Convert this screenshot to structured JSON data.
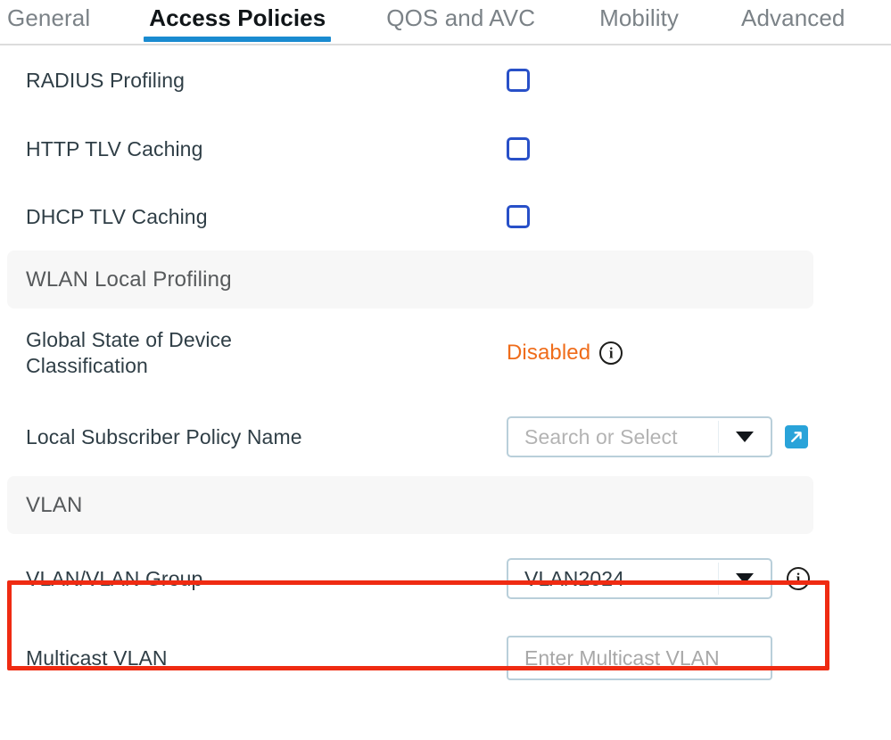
{
  "tabs": [
    {
      "label": "General",
      "active": false
    },
    {
      "label": "Access Policies",
      "active": true
    },
    {
      "label": "QOS and AVC",
      "active": false
    },
    {
      "label": "Mobility",
      "active": false
    },
    {
      "label": "Advanced",
      "active": false
    }
  ],
  "rows": {
    "radius_profiling": {
      "label": "RADIUS Profiling",
      "checked": false
    },
    "http_tlv_caching": {
      "label": "HTTP TLV Caching",
      "checked": false
    },
    "dhcp_tlv_caching": {
      "label": "DHCP TLV Caching",
      "checked": false
    }
  },
  "sections": {
    "wlan_local_profiling": {
      "title": "WLAN Local Profiling"
    },
    "vlan": {
      "title": "VLAN"
    }
  },
  "global_state": {
    "label": "Global State of Device Classification",
    "value": "Disabled",
    "info_icon": "info-circle-icon"
  },
  "local_subscriber_policy": {
    "label": "Local Subscriber Policy Name",
    "placeholder": "Search or Select",
    "value": "",
    "caret_icon": "chevron-down-icon",
    "external_link_icon": "external-link-icon"
  },
  "vlan_group": {
    "label": "VLAN/VLAN Group",
    "value": "VLAN2024",
    "caret_icon": "chevron-down-icon",
    "info_icon": "info-circle-icon"
  },
  "multicast_vlan": {
    "label": "Multicast VLAN",
    "placeholder": "Enter Multicast VLAN",
    "value": ""
  },
  "colors": {
    "active_tab_underline": "#1a8bd0",
    "checkbox_border": "#2850c8",
    "status_disabled": "#ef6c1a",
    "external_link_button": "#29a3d9",
    "highlight_border": "#ef2b12",
    "section_band_bg": "#f7f7f7",
    "field_border": "#b9cfda"
  }
}
